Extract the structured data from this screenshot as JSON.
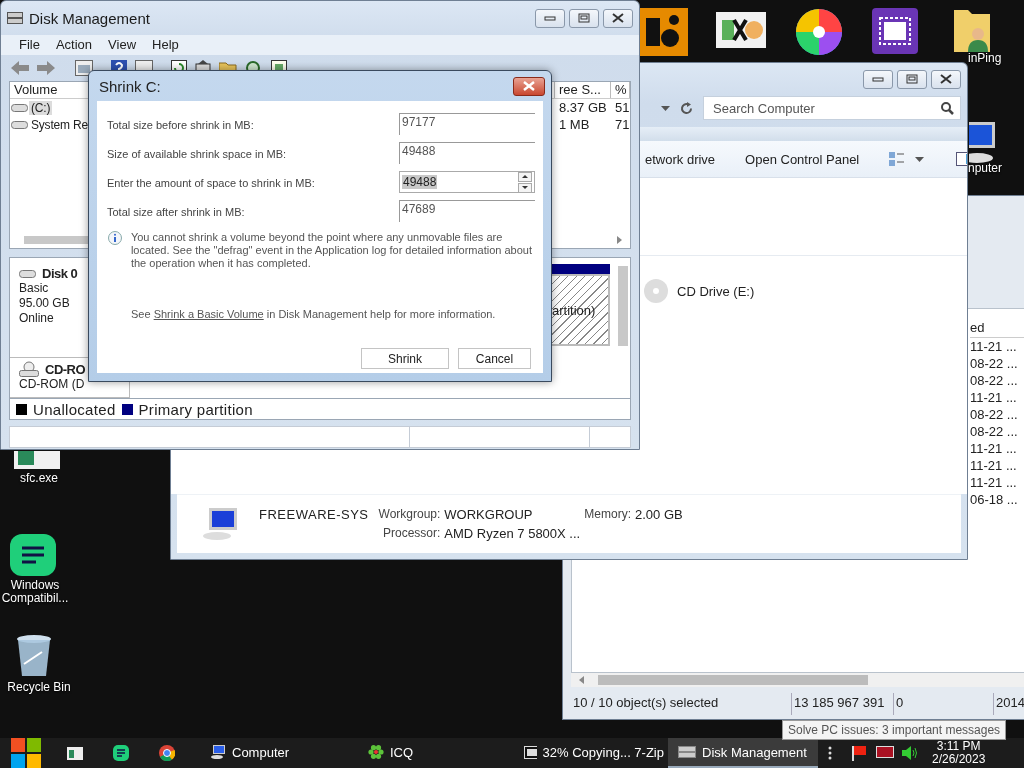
{
  "desktop": {
    "icons": [
      {
        "kind": "de"
      },
      {
        "kind": "hxd"
      },
      {
        "kind": "pinwheel"
      },
      {
        "kind": "cpuz"
      },
      {
        "kind": "user-folder",
        "label": "inPing"
      },
      {
        "kind": "computer",
        "label": "nputer"
      },
      {
        "kind": "sfc",
        "label": "sfc.exe"
      },
      {
        "kind": "compat",
        "label": "Windows Compatibil..."
      },
      {
        "kind": "recycle",
        "label": "Recycle Bin"
      }
    ]
  },
  "file_manager": {
    "column_header": "ed",
    "dates": [
      "11-21 ...",
      "08-22 ...",
      "08-22 ...",
      "11-21 ...",
      "08-22 ...",
      "08-22 ...",
      "11-21 ...",
      "11-21 ...",
      "11-21 ...",
      "06-18 ..."
    ],
    "status": [
      "10 / 10 object(s) selected",
      "13 185 967 391",
      "0",
      "2014"
    ]
  },
  "explorer": {
    "search": {
      "placeholder": "Search Computer"
    },
    "toolbar": [
      "etwork drive",
      "Open Control Panel"
    ],
    "drives": [
      {
        "label": "CD Drive (E:)"
      }
    ],
    "details": {
      "name": "FREEWARE-SYS",
      "props": [
        {
          "label": "Workgroup:",
          "value": "WORKGROUP"
        },
        {
          "label": "Memory:",
          "value": "2.00 GB"
        },
        {
          "label": "Processor:",
          "value": "AMD Ryzen 7 5800X ..."
        }
      ]
    }
  },
  "disk_management": {
    "title": "Disk Management",
    "menu": [
      "File",
      "Action",
      "View",
      "Help"
    ],
    "volume_list": {
      "columns": [
        "Volume",
        "ree S...",
        "%"
      ],
      "rows": [
        {
          "volume": "(C:)",
          "free": "8.37 GB",
          "percent": "51",
          "selected": true
        },
        {
          "volume": "System Re",
          "free": "1 MB",
          "percent": "71",
          "selected": false
        }
      ]
    },
    "disks": [
      {
        "kind": "disk",
        "name": "Disk 0",
        "lines": [
          "Basic",
          "95.00 GB",
          "Online"
        ]
      },
      {
        "kind": "cdrom",
        "name": "CD-RO",
        "lines": [
          "CD-ROM (D"
        ]
      }
    ],
    "partition": {
      "label": "artition)"
    },
    "legend": [
      {
        "label": "Unallocated",
        "color": "#000000"
      },
      {
        "label": "Primary partition",
        "color": "#000080"
      }
    ]
  },
  "shrink_dialog": {
    "title": "Shrink C:",
    "fields": [
      {
        "kind": "readonly",
        "label": "Total size before shrink in MB:",
        "value": "97177"
      },
      {
        "kind": "readonly",
        "label": "Size of available shrink space in MB:",
        "value": "49488"
      },
      {
        "kind": "spinner",
        "label": "Enter the amount of space to shrink in MB:",
        "value": "49488"
      },
      {
        "kind": "readonly",
        "label": "Total size after shrink in MB:",
        "value": "47689"
      }
    ],
    "note": "You cannot shrink a volume beyond the point where any unmovable files are located. See the \"defrag\" event in the Application log for detailed information about the operation when it has completed.",
    "help": {
      "before": "See",
      "link": "Shrink a Basic Volume",
      "after": "in Disk Management help for more information."
    },
    "buttons": [
      "Shrink",
      "Cancel"
    ]
  },
  "taskbar": {
    "pinned": [
      {
        "kind": "app"
      },
      {
        "kind": "notes"
      },
      {
        "kind": "chrome"
      }
    ],
    "apps": [
      {
        "kind": "computer",
        "label": "Computer",
        "selected": false
      },
      {
        "kind": "icq",
        "label": "ICQ",
        "selected": false
      },
      {
        "kind": "zip",
        "label": "32% Copying... 7-Zip",
        "selected": false
      },
      {
        "kind": "disk",
        "label": "Disk Management",
        "selected": true
      }
    ],
    "clock": {
      "time": "3:11 PM",
      "date": "2/26/2023"
    },
    "tooltip": "Solve PC issues: 3 important messages"
  }
}
